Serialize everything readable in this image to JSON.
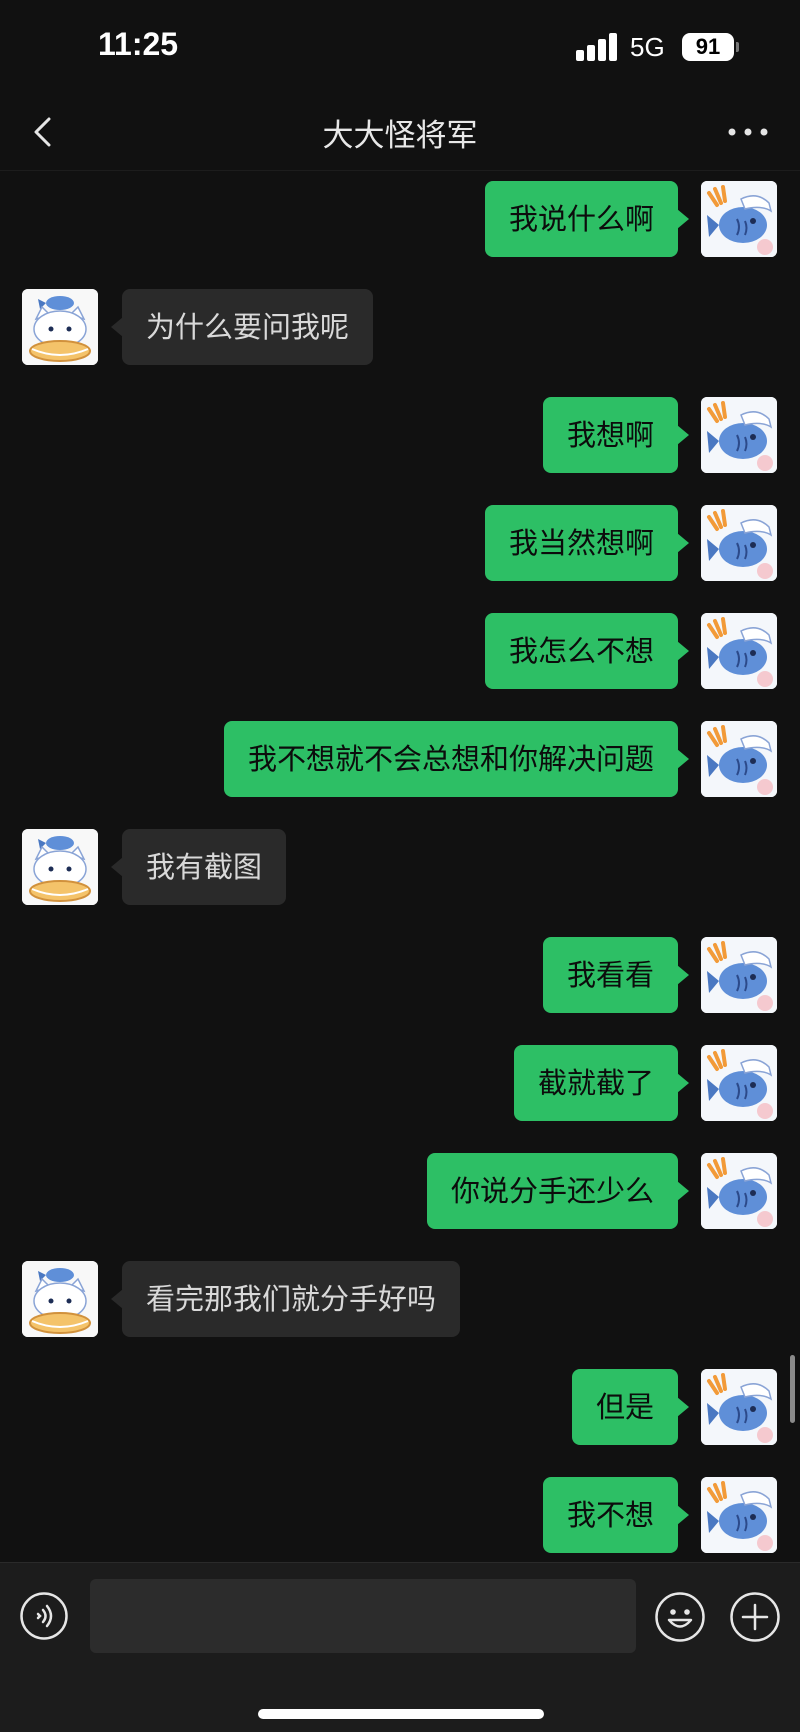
{
  "status_bar": {
    "time": "11:25",
    "network": "5G",
    "battery": "91"
  },
  "nav": {
    "title": "大大怪将军",
    "back_icon": "chevron-left-icon",
    "more_icon": "ellipsis-icon"
  },
  "messages": [
    {
      "side": "right",
      "text": "我说什么啊"
    },
    {
      "side": "left",
      "text": "为什么要问我呢"
    },
    {
      "side": "right",
      "text": "我想啊"
    },
    {
      "side": "right",
      "text": "我当然想啊"
    },
    {
      "side": "right",
      "text": "我怎么不想"
    },
    {
      "side": "right",
      "text": "我不想就不会总想和你解决问题"
    },
    {
      "side": "left",
      "text": "我有截图"
    },
    {
      "side": "right",
      "text": "我看看"
    },
    {
      "side": "right",
      "text": "截就截了"
    },
    {
      "side": "right",
      "text": "你说分手还少么"
    },
    {
      "side": "left",
      "text": "看完那我们就分手好吗"
    },
    {
      "side": "right",
      "text": "但是"
    },
    {
      "side": "right",
      "text": "我不想"
    }
  ],
  "input_bar": {
    "voice_icon": "voice-icon",
    "input_value": "",
    "emoji_icon": "emoji-icon",
    "plus_icon": "plus-icon"
  },
  "colors": {
    "background": "#111111",
    "bubble_self": "#2dbf65",
    "bubble_other": "#2a2a2a"
  }
}
